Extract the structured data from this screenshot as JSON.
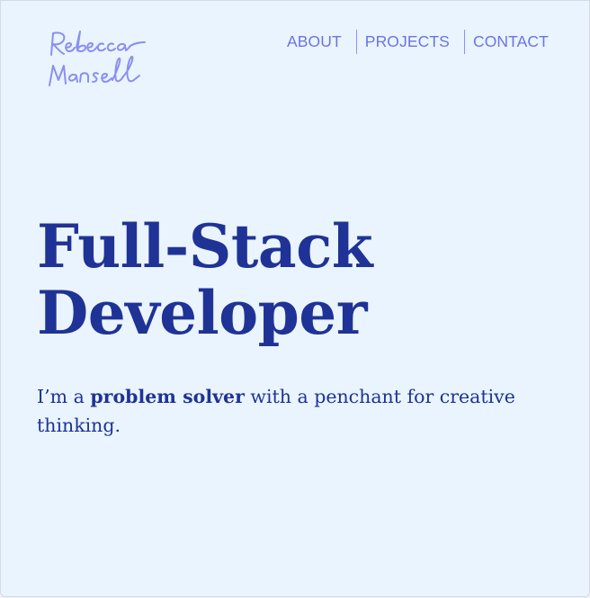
{
  "brand": {
    "signature": "Rebecca Mansell"
  },
  "nav": {
    "items": [
      {
        "label": "ABOUT"
      },
      {
        "label": "PROJECTS"
      },
      {
        "label": "CONTACT"
      }
    ]
  },
  "hero": {
    "title_line1": "Full-Stack",
    "title_line2": "Developer"
  },
  "intro": {
    "prefix": "I’m a ",
    "highlight": "problem solver",
    "suffix": " with a penchant for creative thinking."
  },
  "colors": {
    "background": "#eaf4fe",
    "heading": "#1f3396",
    "nav_link": "#6b74e3",
    "signature": "#8a8ff0"
  }
}
